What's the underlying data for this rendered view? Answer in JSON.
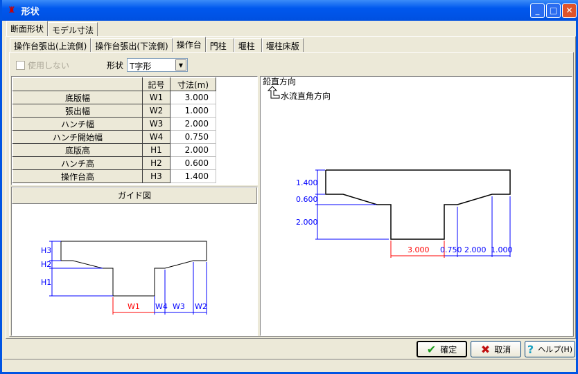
{
  "window": {
    "title": "形状"
  },
  "outer_tabs": [
    "断面形状",
    "モデル寸法"
  ],
  "inner_tabs": [
    "操作台張出(上流側)",
    "操作台張出(下流側)",
    "操作台",
    "門柱",
    "堰柱",
    "堰柱床版"
  ],
  "options": {
    "unused_label": "使用しない",
    "shape_label": "形状",
    "shape_value": "T字形"
  },
  "table": {
    "headers": [
      "",
      "記号",
      "寸法(m)"
    ],
    "rows": [
      {
        "name": "底版幅",
        "symbol": "W1",
        "value": "3.000"
      },
      {
        "name": "張出幅",
        "symbol": "W2",
        "value": "1.000"
      },
      {
        "name": "ハンチ幅",
        "symbol": "W3",
        "value": "2.000"
      },
      {
        "name": "ハンチ開始幅",
        "symbol": "W4",
        "value": "0.750"
      },
      {
        "name": "底版高",
        "symbol": "H1",
        "value": "2.000"
      },
      {
        "name": "ハンチ高",
        "symbol": "H2",
        "value": "0.600"
      },
      {
        "name": "操作台高",
        "symbol": "H3",
        "value": "1.400"
      }
    ]
  },
  "guide": {
    "title": "ガイド図",
    "labels": {
      "H3": "H3",
      "H2": "H2",
      "H1": "H1",
      "W1": "W1",
      "W4": "W4",
      "W3": "W3",
      "W2": "W2"
    }
  },
  "diagram": {
    "vertical_label": "鉛直方向",
    "flow_label": "水流直角方向",
    "dims": {
      "h3": "1.400",
      "h2": "0.600",
      "h1": "2.000",
      "w1": "3.000",
      "w4": "0.750",
      "w3": "2.000",
      "w2": "1.000"
    }
  },
  "buttons": {
    "ok": "確定",
    "cancel": "取消",
    "help": "ヘルプ(H)"
  }
}
